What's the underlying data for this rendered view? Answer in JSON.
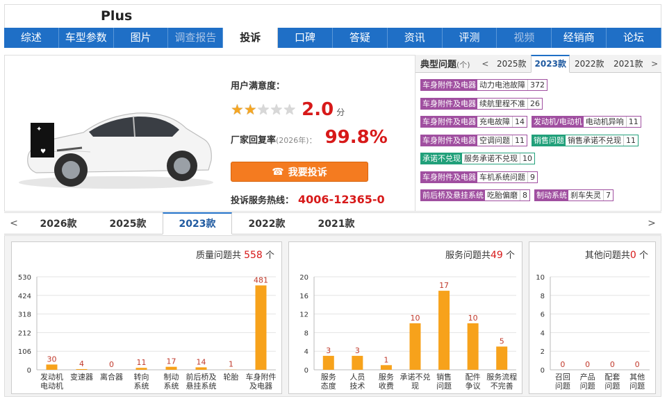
{
  "header": {
    "title": "Plus"
  },
  "nav": [
    {
      "label": "综述",
      "state": "normal"
    },
    {
      "label": "车型参数",
      "state": "normal"
    },
    {
      "label": "图片",
      "state": "normal"
    },
    {
      "label": "调查报告",
      "state": "disabled"
    },
    {
      "label": "投诉",
      "state": "active"
    },
    {
      "label": "口碑",
      "state": "normal"
    },
    {
      "label": "答疑",
      "state": "normal"
    },
    {
      "label": "资讯",
      "state": "normal"
    },
    {
      "label": "评测",
      "state": "normal"
    },
    {
      "label": "视频",
      "state": "disabled"
    },
    {
      "label": "经销商",
      "state": "normal"
    },
    {
      "label": "论坛",
      "state": "normal"
    }
  ],
  "summary": {
    "satisfaction_label": "用户满意度：",
    "rating": 2.0,
    "rating_max": 5,
    "rating_text": "2.0",
    "rating_unit": "分",
    "reply_label": "厂家回复率",
    "reply_year": "(2026年)：",
    "reply_rate": "99.8%",
    "complain_button": "我要投诉",
    "hotline_label": "投诉服务热线：",
    "hotline": "4006-12365-0"
  },
  "typical_issues": {
    "title": "典型问题",
    "title_suffix": "(个)",
    "years": [
      "2025款",
      "2023款",
      "2022款",
      "2021款"
    ],
    "active_year": "2023款",
    "rows": [
      [
        {
          "category": "车身附件及电器",
          "issue": "动力电池故障",
          "count": "372",
          "color": "purple"
        }
      ],
      [
        {
          "category": "车身附件及电器",
          "issue": "续航里程不准",
          "count": "26",
          "color": "purple"
        }
      ],
      [
        {
          "category": "车身附件及电器",
          "issue": "充电故障",
          "count": "14",
          "color": "purple"
        },
        {
          "category": "发动机/电动机",
          "issue": "电动机异响",
          "count": "11",
          "color": "purple"
        }
      ],
      [
        {
          "category": "车身附件及电器",
          "issue": "空调问题",
          "count": "11",
          "color": "purple"
        },
        {
          "category": "销售问题",
          "issue": "销售承诺不兑现",
          "count": "11",
          "color": "green"
        }
      ],
      [
        {
          "category": "承诺不兑现",
          "issue": "服务承诺不兑现",
          "count": "10",
          "color": "green"
        }
      ],
      [
        {
          "category": "车身附件及电器",
          "issue": "车机系统问题",
          "count": "9",
          "color": "purple"
        }
      ],
      [
        {
          "category": "前后桥及悬挂系统",
          "issue": "吃胎偏磨",
          "count": "8",
          "color": "purple"
        },
        {
          "category": "制动系统",
          "issue": "刹车失灵",
          "count": "7",
          "color": "purple"
        }
      ]
    ]
  },
  "year_tabs": {
    "items": [
      "2026款",
      "2025款",
      "2023款",
      "2022款",
      "2021款"
    ],
    "active": "2023款"
  },
  "colors": {
    "nav": "#1f6fc6",
    "accent_red": "#d71919",
    "button_orange": "#f47b20",
    "bar": "#f7a21b",
    "tag_purple": "#a04fa0",
    "tag_green": "#21a07a"
  },
  "chart_data": [
    {
      "type": "bar",
      "title_prefix": "质量问题共",
      "total": "558",
      "title_suffix": "个",
      "categories": [
        [
          "发动机",
          "电动机"
        ],
        [
          "变速器"
        ],
        [
          "离合器"
        ],
        [
          "转向",
          "系统"
        ],
        [
          "制动",
          "系统"
        ],
        [
          "前后桥及",
          "悬挂系统"
        ],
        [
          "轮胎"
        ],
        [
          "车身附件",
          "及电器"
        ]
      ],
      "values": [
        30,
        4,
        0,
        11,
        17,
        14,
        1,
        481
      ],
      "yticks": [
        "0",
        "106",
        "212",
        "318",
        "424",
        "530"
      ],
      "ylim": [
        0,
        530
      ],
      "grid": true
    },
    {
      "type": "bar",
      "title_prefix": "服务问题共",
      "total": "49",
      "title_suffix": "个",
      "categories": [
        [
          "服务",
          "态度"
        ],
        [
          "人员",
          "技术"
        ],
        [
          "服务",
          "收费"
        ],
        [
          "承诺不兑",
          "现"
        ],
        [
          "销售",
          "问题"
        ],
        [
          "配件",
          "争议"
        ],
        [
          "服务流程",
          "不完善"
        ]
      ],
      "values": [
        3,
        3,
        1,
        10,
        17,
        10,
        5
      ],
      "yticks": [
        "0",
        "4",
        "8",
        "12",
        "16",
        "20"
      ],
      "ylim": [
        0,
        20
      ],
      "grid": true
    },
    {
      "type": "bar",
      "title_prefix": "其他问题共",
      "total": "0",
      "title_suffix": "个",
      "categories": [
        [
          "召回",
          "问题"
        ],
        [
          "产品",
          "问题"
        ],
        [
          "配套",
          "问题"
        ],
        [
          "其他",
          "问题"
        ]
      ],
      "values": [
        0,
        0,
        0,
        0
      ],
      "yticks": [
        "0",
        "2",
        "4",
        "6",
        "8",
        "10"
      ],
      "ylim": [
        0,
        10
      ],
      "grid": true
    }
  ]
}
